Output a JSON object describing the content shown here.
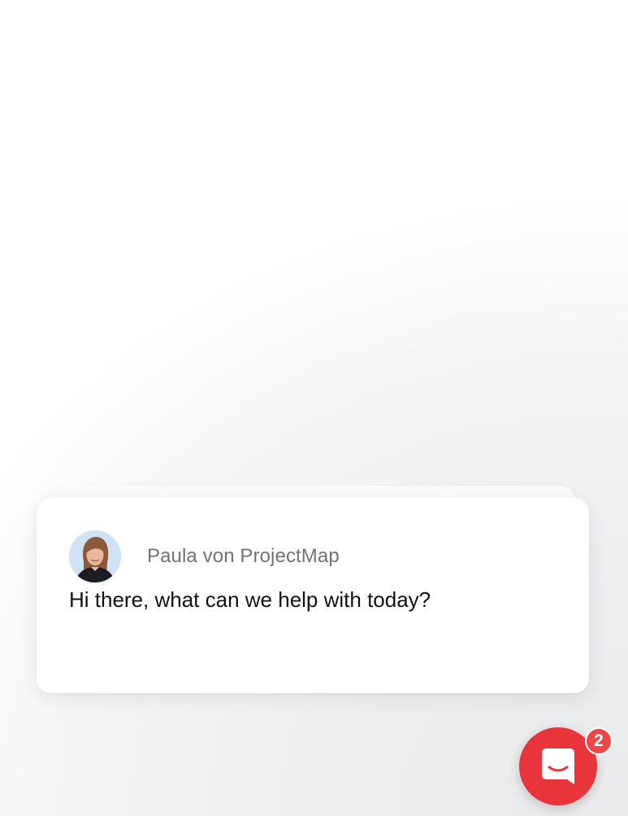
{
  "notification": {
    "sender": "Paula von ProjectMap",
    "message": "Hi there, what can we help with today?"
  },
  "launcher": {
    "badge_count": "2",
    "icon": "chat-bubble-icon",
    "color": "#e8353b"
  }
}
